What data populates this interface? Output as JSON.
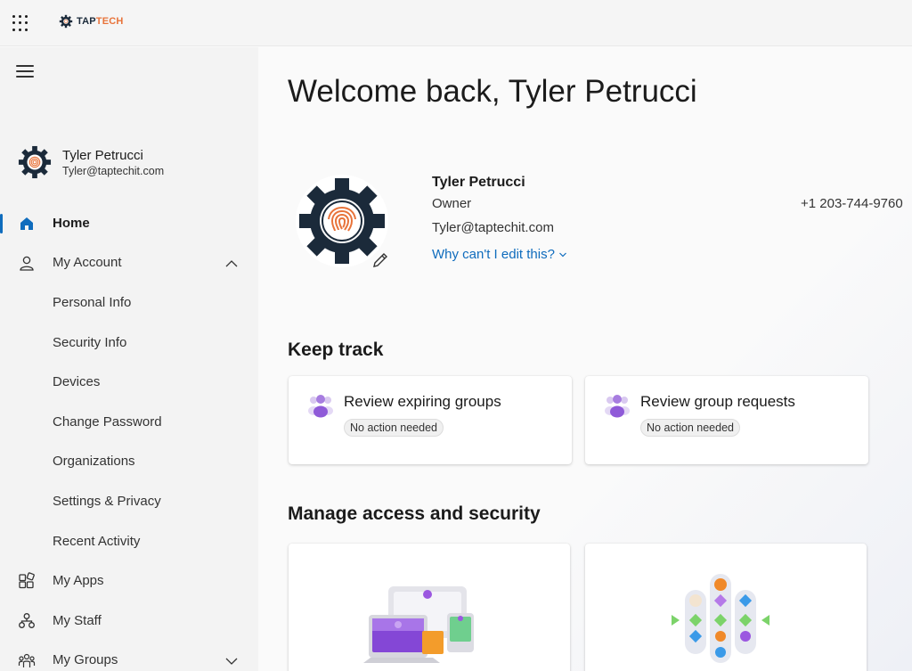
{
  "topbar": {
    "logo_tap": "TAP",
    "logo_tech": "TECH"
  },
  "sidebar": {
    "user": {
      "name": "Tyler Petrucci",
      "email": "Tyler@taptechit.com"
    },
    "nav": {
      "home": "Home",
      "my_account": "My Account",
      "personal_info": "Personal Info",
      "security_info": "Security Info",
      "devices": "Devices",
      "change_password": "Change Password",
      "organizations": "Organizations",
      "settings_privacy": "Settings & Privacy",
      "recent_activity": "Recent Activity",
      "my_apps": "My Apps",
      "my_staff": "My Staff",
      "my_groups": "My Groups"
    }
  },
  "main": {
    "welcome": "Welcome back, Tyler Petrucci",
    "profile": {
      "name": "Tyler Petrucci",
      "role": "Owner",
      "email": "Tyler@taptechit.com",
      "why_link": "Why can't I edit this?",
      "phone": "+1 203-744-9760"
    },
    "keep_track": {
      "title": "Keep track",
      "cards": [
        {
          "title": "Review expiring groups",
          "status": "No action needed"
        },
        {
          "title": "Review group requests",
          "status": "No action needed"
        }
      ]
    },
    "manage": {
      "title": "Manage access and security"
    }
  },
  "colors": {
    "accent": "#0f6cbd",
    "brand_orange": "#e8733a",
    "brand_navy": "#1b2a3a"
  }
}
